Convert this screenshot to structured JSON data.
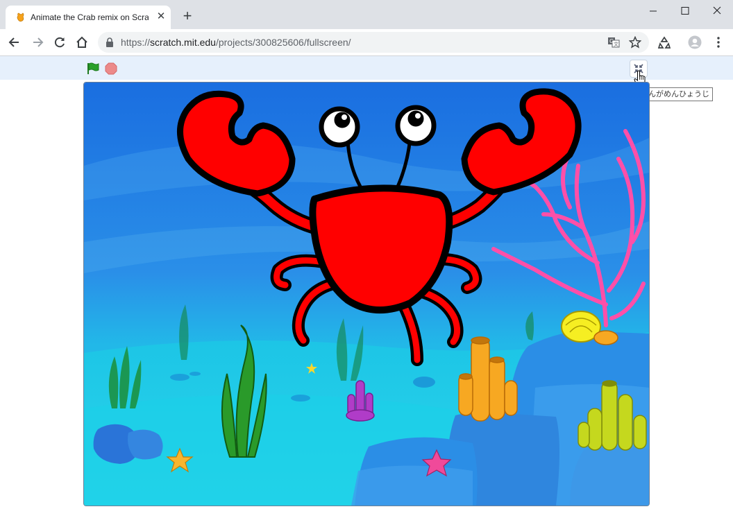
{
  "browser": {
    "tab": {
      "title": "Animate the Crab remix on Scratch",
      "close_glyph": "✕",
      "favicon": "scratch-cat-icon"
    },
    "new_tab_glyph": "+",
    "window_controls": [
      "minimize-icon",
      "maximize-icon",
      "close-icon"
    ],
    "url": {
      "scheme": "https://",
      "host": "scratch.mit.edu",
      "path": "/projects/300825606/fullscreen/"
    },
    "toolbar_icons": [
      "back-icon",
      "forward-icon",
      "reload-icon",
      "home-icon",
      "translate-icon",
      "bookmark-star-icon",
      "extension-icon",
      "profile-icon",
      "menu-icon"
    ]
  },
  "scratch": {
    "controls": [
      "green-flag-icon",
      "stop-icon",
      "unfullscreen-icon"
    ],
    "tooltip": "ぜんがめんひょうじ",
    "stage_scene": "underwater-crab"
  },
  "colors": {
    "scratch_bar": "#e6f0fc",
    "crab_red": "#ff0000",
    "water_deep": "#1f7fe6",
    "water_light": "#22c8e8",
    "coral_pink": "#ff4fa8",
    "green_flag": "#2aa02a",
    "stop_red": "#ec8a8a"
  }
}
